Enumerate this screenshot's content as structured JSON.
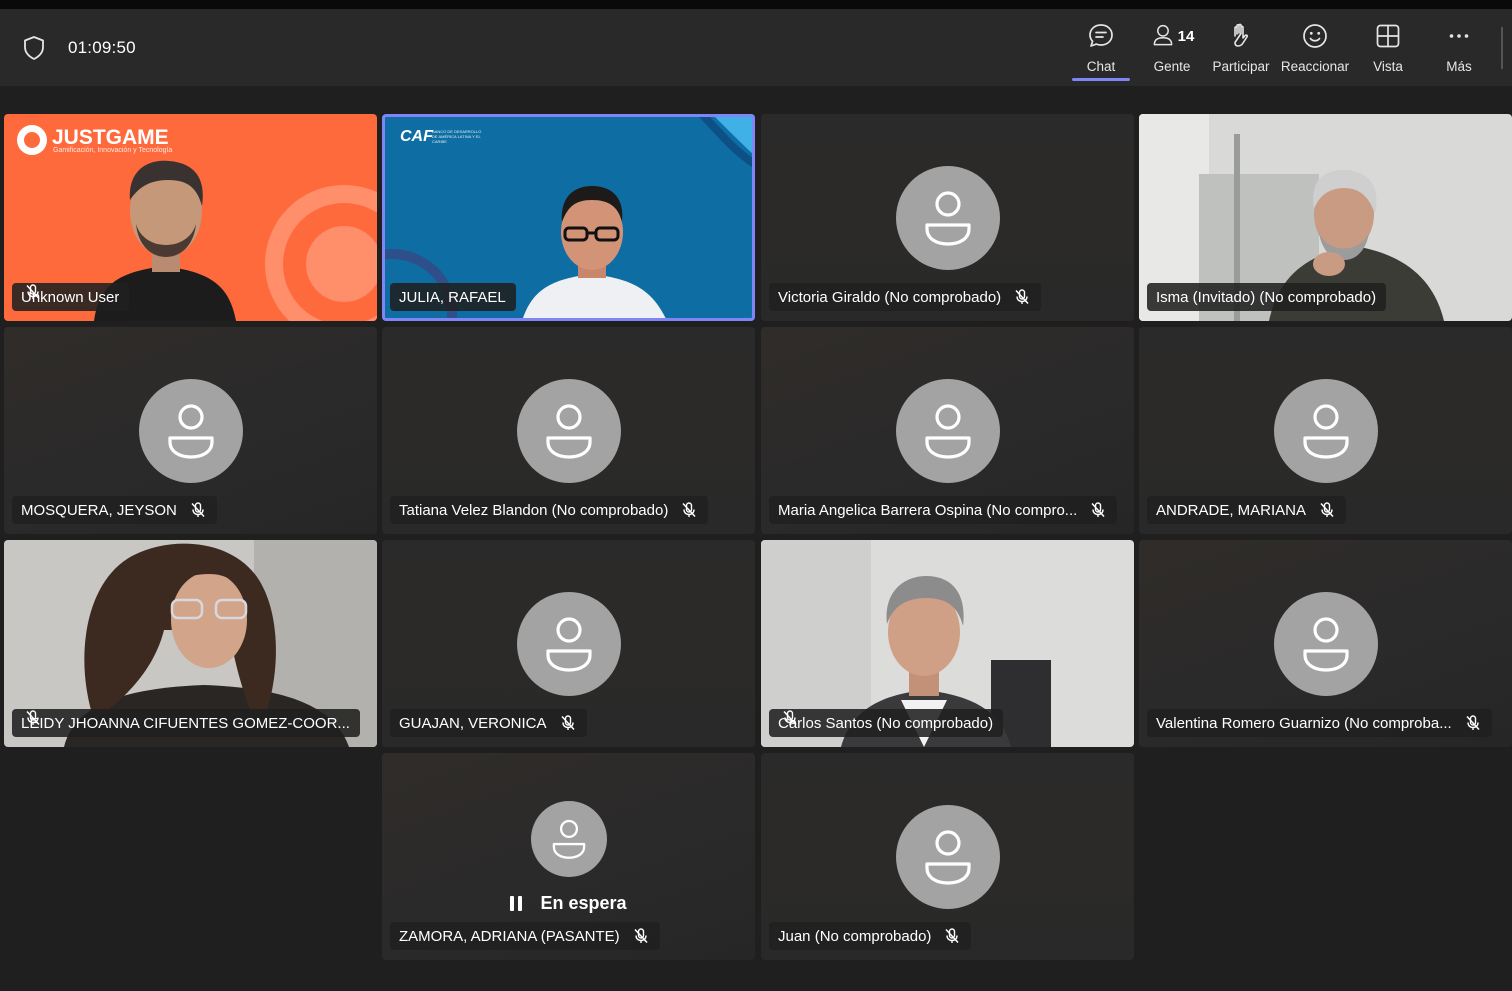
{
  "toolbar": {
    "timer": "01:09:50",
    "chat_label": "Chat",
    "people_label": "Gente",
    "people_count": "14",
    "raise_label": "Participar",
    "react_label": "Reaccionar",
    "view_label": "Vista",
    "more_label": "Más"
  },
  "participants": [
    {
      "name": "Unknown User"
    },
    {
      "name": "JULIA, RAFAEL"
    },
    {
      "name": "Victoria Giraldo (No comprobado)"
    },
    {
      "name": "Isma (Invitado) (No comprobado)"
    },
    {
      "name": "MOSQUERA, JEYSON"
    },
    {
      "name": "Tatiana Velez Blandon (No comprobado)"
    },
    {
      "name": "Maria Angelica Barrera Ospina (No compro..."
    },
    {
      "name": "ANDRADE, MARIANA"
    },
    {
      "name": "LEIDY JHOANNA CIFUENTES GOMEZ-COOR..."
    },
    {
      "name": "GUAJAN, VERONICA"
    },
    {
      "name": "Carlos Santos (No comprobado)"
    },
    {
      "name": "Valentina Romero Guarnizo (No comproba..."
    },
    {
      "name": "ZAMORA, ADRIANA (PASANTE)",
      "status": "En espera"
    },
    {
      "name": "Juan (No comprobado)"
    }
  ],
  "branding": {
    "justgame_logo": "JUSTGAME",
    "justgame_tagline": "Gamificación, Innovación y Tecnología",
    "caf_logo": "CAF",
    "caf_tagline": "BANCO DE DESARROLLO DE AMÉRICA LATINA Y EL CARIBE"
  },
  "colors": {
    "accent": "#7f85f5",
    "toolbar_bg": "#292929",
    "stage_bg": "#1f1f1f",
    "avatar_bg": "#a3a3a3",
    "justgame_orange": "#ff6a3d",
    "caf_blue": "#0e6ea3"
  }
}
